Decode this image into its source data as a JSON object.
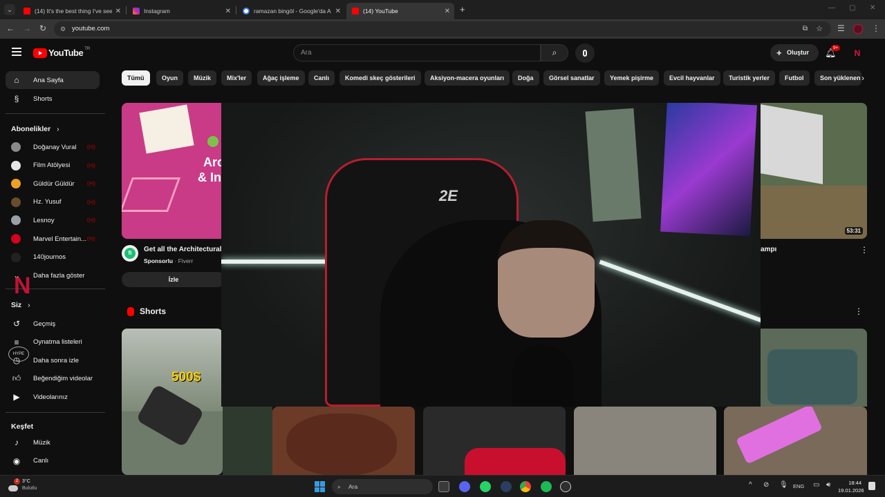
{
  "browser": {
    "tabs": [
      {
        "title": "(14) It's the best thing I've seen",
        "favicon_color": "#ff0000"
      },
      {
        "title": "Instagram",
        "favicon_color": "#d6249f"
      },
      {
        "title": "ramazan bingöl - Google'da Ar",
        "favicon_color": "#4285f4"
      },
      {
        "title": "(14) YouTube",
        "favicon_color": "#ff0000"
      }
    ],
    "new_tab": "+",
    "url": "youtube.com"
  },
  "youtube": {
    "logo_text": "YouTube",
    "logo_region": "TR",
    "search_placeholder": "Ara",
    "create_label": "Oluştur",
    "notification_count": "9+",
    "accent_color": "#ff0000",
    "chips": [
      "Tümü",
      "Oyun",
      "Müzik",
      "Mix'ler",
      "Ağaç işleme",
      "Canlı",
      "Komedi skeç gösterileri",
      "Aksiyon-macera oyunları",
      "Doğa",
      "Görsel sanatlar",
      "Yemek pişirme",
      "Evcil hayvanlar",
      "Turistik yerler",
      "Futbol",
      "Son yüklenen"
    ],
    "sidebar": {
      "main": [
        {
          "label": "Ana Sayfa",
          "icon": "home-icon"
        },
        {
          "label": "Shorts",
          "icon": "shorts-icon"
        }
      ],
      "subs_title": "Abonelikler",
      "subs": [
        {
          "label": "Doğanay Vural",
          "color": "#8a8a8a"
        },
        {
          "label": "Film Atölyesi",
          "color": "#e6e6e6"
        },
        {
          "label": "Güldür Güldür",
          "color": "#f0a020"
        },
        {
          "label": "Hz. Yusuf",
          "color": "#6b4b2e"
        },
        {
          "label": "Lesnoy",
          "color": "#9aa0a6"
        },
        {
          "label": "Marvel Entertain...",
          "color": "#d0021b"
        },
        {
          "label": "140journos",
          "color": "#222222"
        }
      ],
      "show_more": "Daha fazla göster",
      "you_title": "Siz",
      "you": [
        {
          "label": "Geçmiş",
          "icon": "history-icon"
        },
        {
          "label": "Oynatma listeleri",
          "icon": "playlist-icon"
        },
        {
          "label": "Daha sonra izle",
          "icon": "clock-icon"
        },
        {
          "label": "Beğendiğim videolar",
          "icon": "like-icon"
        },
        {
          "label": "Videolarınız",
          "icon": "video-icon"
        }
      ],
      "explore_title": "Keşfet",
      "explore": [
        {
          "label": "Müzik",
          "icon": "music-icon"
        },
        {
          "label": "Canlı",
          "icon": "live-icon"
        }
      ]
    },
    "ad": {
      "title": "Get all the Architectural",
      "sponsor": "Sponsorlu",
      "advertiser": "Fiverr",
      "cta": "İzle",
      "thumb_text_1": "Arc",
      "thumb_text_2": "& Inte"
    },
    "video_right": {
      "duration": "53:31",
      "title_fragment": "ampı"
    },
    "shorts_title": "Shorts",
    "short_price": "500$"
  },
  "taskbar": {
    "weather_temp": "3°C",
    "weather_desc": "Bulutlu",
    "weather_badge": "2",
    "search_placeholder": "Ara",
    "lang": "ENG",
    "time": "18:44",
    "date": "19.01.2026"
  }
}
